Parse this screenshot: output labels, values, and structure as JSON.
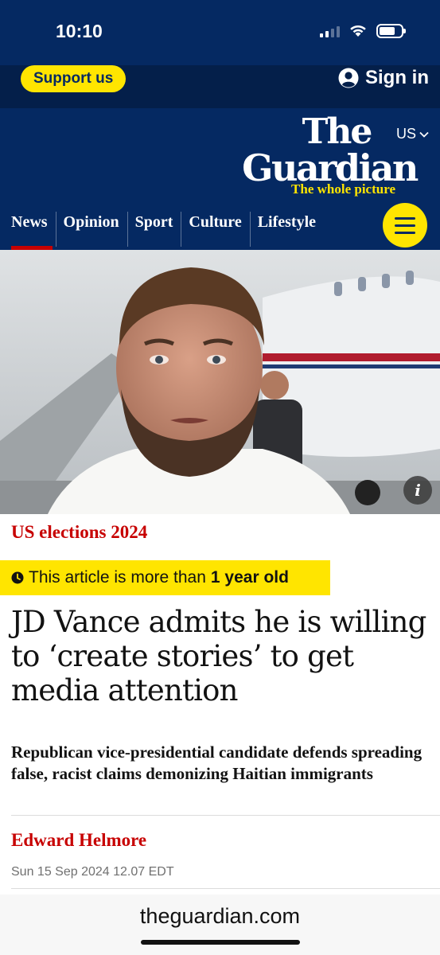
{
  "status_bar": {
    "time": "10:10"
  },
  "topbar": {
    "support_label": "Support us",
    "signin_label": "Sign in"
  },
  "masthead": {
    "logo_line1": "The",
    "logo_line2": "Guardian",
    "tagline": "The whole picture",
    "edition": "US",
    "nav": [
      "News",
      "Opinion",
      "Sport",
      "Culture",
      "Lifestyle"
    ],
    "active_nav": "News"
  },
  "article": {
    "kicker": "US elections 2024",
    "age_notice_prefix": "This article is more than",
    "age_notice_bold": "1 year old",
    "headline": "JD Vance admits he is willing to ‘create stories’ to get media attention",
    "standfirst": "Republican vice-presidential candidate defends spreading false, racist claims demonizing Haitian immigrants",
    "byline": "Edward Helmore",
    "dateline": "Sun 15 Sep 2024 12.07 EDT"
  },
  "browser": {
    "url": "theguardian.com"
  },
  "colors": {
    "brand_blue": "#052962",
    "yellow": "#ffe500",
    "news_red": "#c70000"
  },
  "icons": [
    "signal-icon",
    "wifi-icon",
    "battery-icon",
    "user-icon",
    "chevron-down-icon",
    "menu-icon",
    "info-icon",
    "clock-icon"
  ]
}
